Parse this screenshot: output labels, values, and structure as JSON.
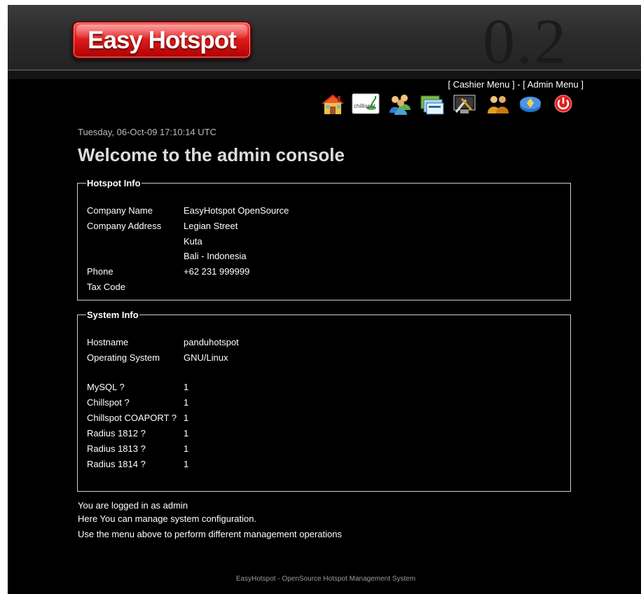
{
  "header": {
    "logo_text": "Easy Hotspot",
    "version": "0.2"
  },
  "topmenu": {
    "cashier_menu": "[ Cashier Menu ]",
    "separator": " - ",
    "admin_menu": "[ Admin Menu ]"
  },
  "iconbar": [
    "home-icon",
    "chillispot-icon",
    "users-icon",
    "vouchers-icon",
    "tools-icon",
    "groups-icon",
    "about-icon",
    "logout-icon"
  ],
  "iconbar_text": {
    "chillispot": "chillispot"
  },
  "main": {
    "date": "Tuesday, 06-Oct-09 17:10:14 UTC",
    "title": "Welcome to the admin console"
  },
  "hotspot_info": {
    "legend": "Hotspot Info",
    "rows": [
      {
        "label": "Company Name",
        "value": "EasyHotspot OpenSource"
      },
      {
        "label": "Company Address",
        "value": "Legian Street"
      },
      {
        "label": "",
        "value": "Kuta"
      },
      {
        "label": "",
        "value": "Bali - Indonesia"
      },
      {
        "label": "Phone",
        "value": "+62 231 999999"
      },
      {
        "label": "Tax Code",
        "value": ""
      }
    ]
  },
  "system_info": {
    "legend": "System Info",
    "rows": [
      {
        "label": "Hostname",
        "value": "panduhotspot"
      },
      {
        "label": "Operating System",
        "value": "GNU/Linux"
      },
      {
        "label": "MySQL ?",
        "value": "1"
      },
      {
        "label": "Chillspot ?",
        "value": "1"
      },
      {
        "label": "Chillspot COAPORT ?",
        "value": "1"
      },
      {
        "label": "Radius 1812 ?",
        "value": "1"
      },
      {
        "label": "Radius 1813 ?",
        "value": "1"
      },
      {
        "label": "Radius 1814 ?",
        "value": "1"
      }
    ]
  },
  "footer": {
    "logged_in": "You are logged in as admin",
    "manage": "Here You can manage system configuration.",
    "use_menu": "Use the menu above to perform different management operations",
    "copyright": "EasyHotspot - OpenSource Hotspot Management System"
  }
}
